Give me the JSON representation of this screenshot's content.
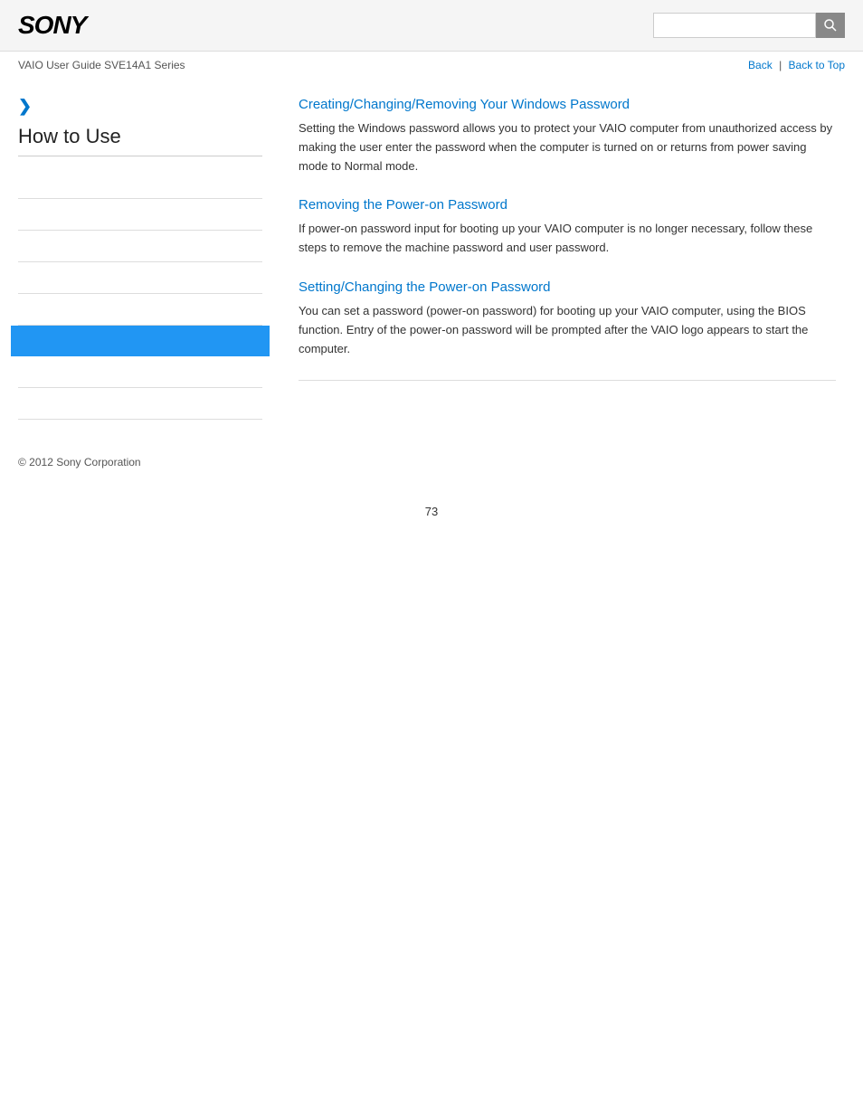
{
  "header": {
    "logo": "SONY",
    "search_placeholder": ""
  },
  "navbar": {
    "guide_title": "VAIO User Guide SVE14A1 Series",
    "back_label": "Back",
    "back_to_top_label": "Back to Top"
  },
  "sidebar": {
    "chevron": "❯",
    "title": "How to Use",
    "nav_items": [
      {
        "label": "",
        "active": false
      },
      {
        "label": "",
        "active": false
      },
      {
        "label": "",
        "active": false
      },
      {
        "label": "",
        "active": false
      },
      {
        "label": "",
        "active": false
      },
      {
        "label": "",
        "active": true
      },
      {
        "label": "",
        "active": false
      },
      {
        "label": "",
        "active": false
      }
    ]
  },
  "content": {
    "sections": [
      {
        "title": "Creating/Changing/Removing Your Windows Password",
        "text": "Setting the Windows password allows you to protect your VAIO computer from unauthorized access by making the user enter the password when the computer is turned on or returns from power saving mode to Normal mode."
      },
      {
        "title": "Removing the Power-on Password",
        "text": "If power-on password input for booting up your VAIO computer is no longer necessary, follow these steps to remove the machine password and user password."
      },
      {
        "title": "Setting/Changing the Power-on Password",
        "text": "You can set a password (power-on password) for booting up your VAIO computer, using the BIOS function. Entry of the power-on password will be prompted after the VAIO logo appears to start the computer."
      }
    ]
  },
  "footer": {
    "copyright": "© 2012 Sony Corporation"
  },
  "page_number": "73",
  "colors": {
    "link": "#0077cc",
    "active_sidebar": "#2196F3",
    "header_bg": "#f5f5f5"
  }
}
